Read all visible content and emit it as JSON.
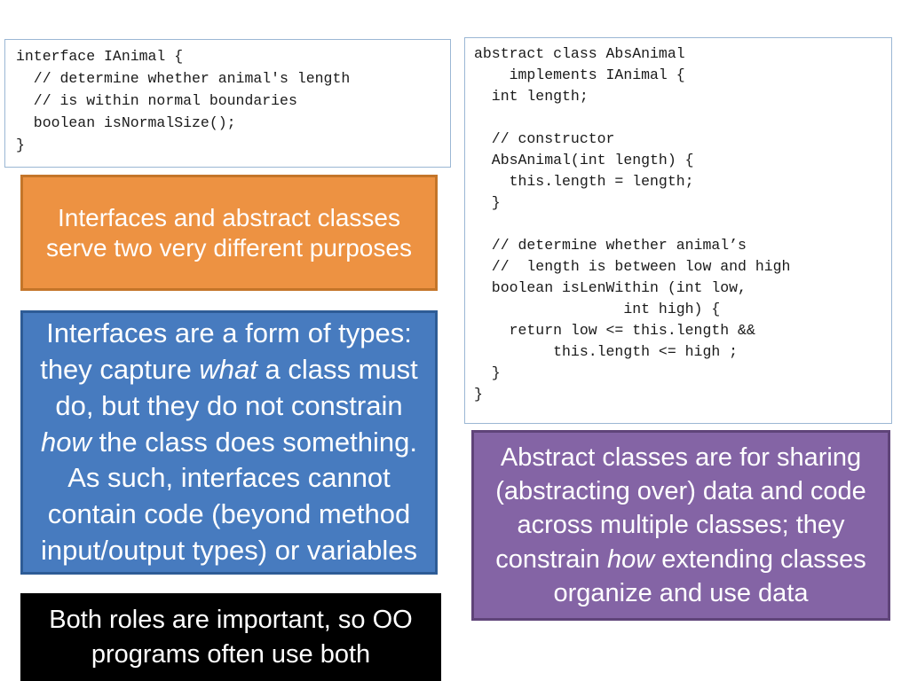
{
  "slide": {
    "title": "Interfaces and abstract classes"
  },
  "code_blocks": {
    "interface": {
      "name": "IAnimal interface code",
      "text": "interface IAnimal {\n  // determine whether animal's length\n  // is within normal boundaries\n  boolean isNormalSize();\n}"
    },
    "abstract": {
      "name": "AbsAnimal abstract class code",
      "text": "abstract class AbsAnimal\n    implements IAnimal {\n  int length;\n\n  // constructor\n  AbsAnimal(int length) {\n    this.length = length;\n  }\n\n  // determine whether animal’s\n  //  length is between low and high\n  boolean isLenWithin (int low,\n                 int high) {\n    return low <= this.length &&\n         this.length <= high ;\n  }\n}"
    }
  },
  "callouts": {
    "orange": {
      "label": "purposes-callout",
      "text": "Interfaces and abstract classes serve two very different purposes",
      "bg_color": "#ED9242",
      "border_color": "#C47529",
      "text_color": "#FFFFFF"
    },
    "blue": {
      "label": "interfaces-callout",
      "text_parts": [
        {
          "text": "Interfaces are a form of types: they capture ",
          "italic": false
        },
        {
          "text": "what",
          "italic": true
        },
        {
          "text": " a class must do, but they do not constrain ",
          "italic": false
        },
        {
          "text": "how",
          "italic": true
        },
        {
          "text": " the class does something. As such, interfaces cannot contain code (beyond method input/output types) or variables",
          "italic": false
        }
      ],
      "bg_color": "#477BBF",
      "border_color": "#2E5C96",
      "text_color": "#FFFFFF"
    },
    "purple": {
      "label": "abstract-classes-callout",
      "text_parts": [
        {
          "text": "Abstract classes are for sharing (abstracting over) data and code across multiple classes; they constrain ",
          "italic": false
        },
        {
          "text": "how",
          "italic": true
        },
        {
          "text": " extending classes organize and use data",
          "italic": false
        }
      ],
      "bg_color": "#8464A5",
      "border_color": "#5F4479",
      "text_color": "#FFFFFF"
    },
    "black": {
      "label": "both-roles-callout",
      "text": "Both roles are important, so OO programs often use both",
      "bg_color": "#000000",
      "border_color": "#000000",
      "text_color": "#FFFFFF"
    }
  }
}
